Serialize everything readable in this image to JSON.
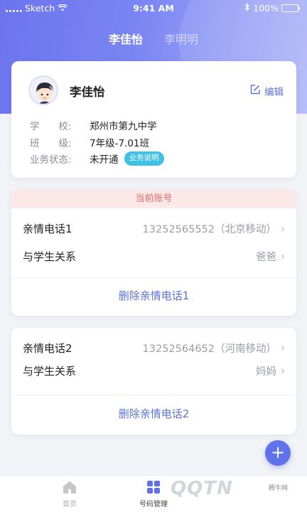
{
  "status_bar": {
    "carrier": "Sketch",
    "time": "9:41 AM",
    "battery": "100%"
  },
  "tabs": [
    {
      "label": "李佳怡",
      "active": true
    },
    {
      "label": "李明明",
      "active": false
    }
  ],
  "profile": {
    "name": "李佳怡",
    "edit_label": "编辑",
    "school_label": "学　　校:",
    "school_value": "郑州市第九中学",
    "class_label": "班　　级:",
    "class_value": "7年级-7.01班",
    "status_label": "业务状态:",
    "status_value": "未开通",
    "status_badge": "业务说明"
  },
  "family_phone_1": {
    "banner": "当前账号",
    "phone_label": "亲情电话1",
    "phone_value": "13252565552（北京移动）",
    "relation_label": "与学生关系",
    "relation_value": "爸爸",
    "delete_label": "删除亲情电话1"
  },
  "family_phone_2": {
    "phone_label": "亲情电话2",
    "phone_value": "13252564652（河南移动）",
    "relation_label": "与学生关系",
    "relation_value": "妈妈",
    "delete_label": "删除亲情电话2"
  },
  "fab": {
    "label": "+"
  },
  "bottom_nav": [
    {
      "label": "首页",
      "icon": "home-icon",
      "active": false
    },
    {
      "label": "号码管理",
      "icon": "grid-icon",
      "active": true
    }
  ],
  "watermark": {
    "text": "QQTN",
    "sub": "腾牛网"
  },
  "colors": {
    "accent": "#5b73d8",
    "header_start": "#6b74ee",
    "banner_bg": "#fde8e8",
    "banner_text": "#e36a6a",
    "badge": "#3fc0e4",
    "fab": "#5f72ec"
  }
}
